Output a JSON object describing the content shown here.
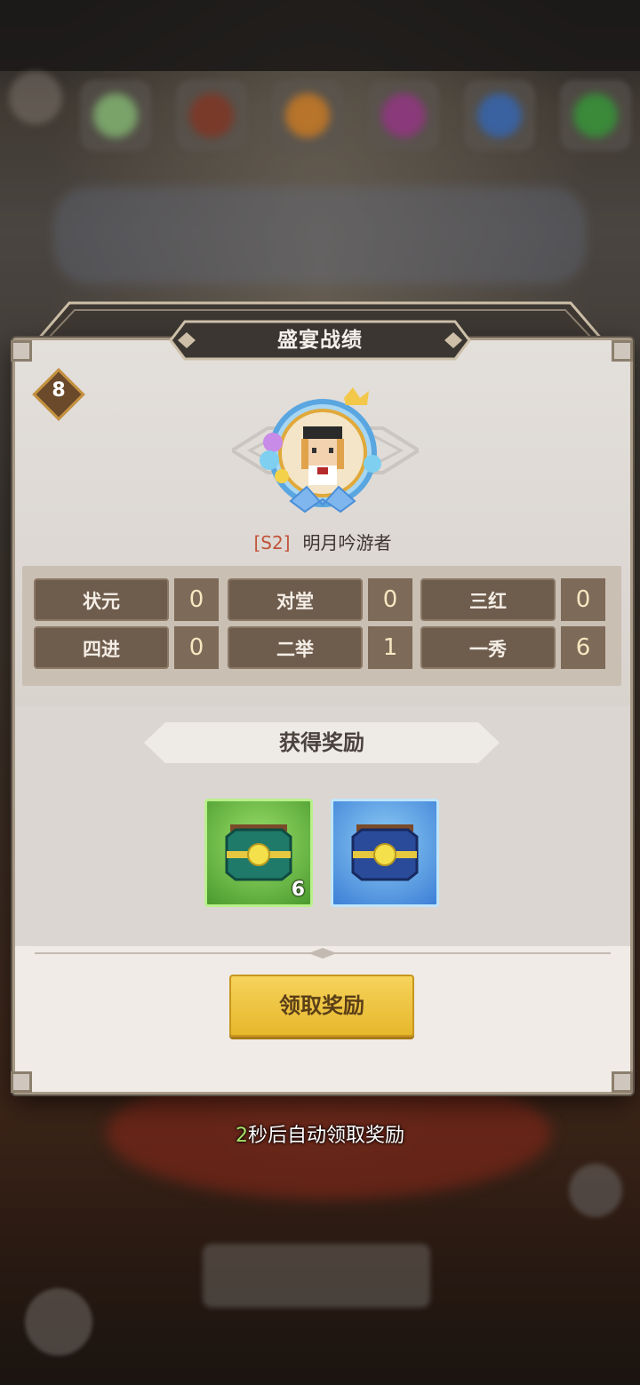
{
  "dialog": {
    "title": "盛宴战绩",
    "rank_badge": "8",
    "player": {
      "season": "[S2]",
      "name": "明月吟游者"
    },
    "stats": [
      {
        "label": "状元",
        "value": "0"
      },
      {
        "label": "对堂",
        "value": "0"
      },
      {
        "label": "三红",
        "value": "0"
      },
      {
        "label": "四进",
        "value": "0"
      },
      {
        "label": "二举",
        "value": "1"
      },
      {
        "label": "一秀",
        "value": "6"
      }
    ],
    "rewards": {
      "title": "获得奖励",
      "items": [
        {
          "icon": "green-chest-icon",
          "count": "6",
          "color": "#5bb83a"
        },
        {
          "icon": "blue-chest-icon",
          "count": "",
          "color": "#3d7fd6"
        }
      ]
    },
    "claim_button": "领取奖励"
  },
  "auto_claim": {
    "seconds": "2",
    "text": "秒后自动领取奖励"
  },
  "colors": {
    "accent_gold": "#f0c640",
    "stat_label_bg": "#6e5c4d",
    "season_red": "#c0543a"
  }
}
